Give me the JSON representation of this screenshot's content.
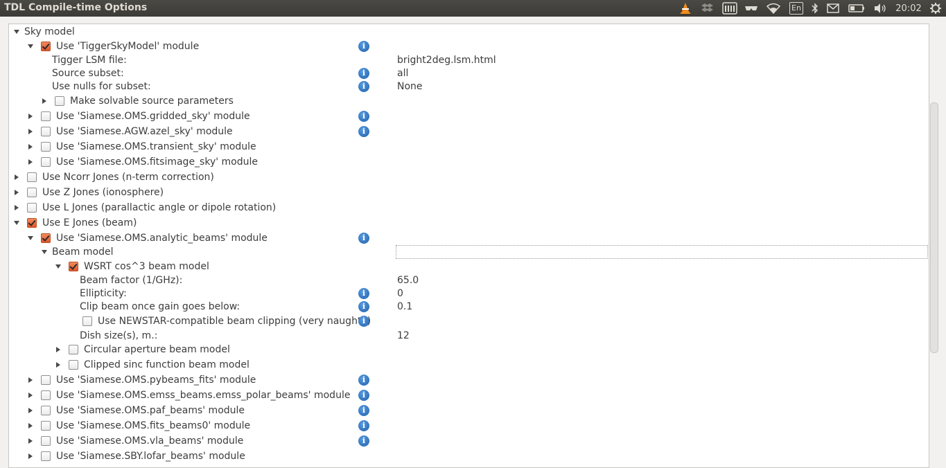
{
  "window": {
    "title": "TDL Compile-time Options"
  },
  "tray": {
    "icons": [
      "vlc-icon",
      "dropbox-icon",
      "im-icon",
      "spy-icon",
      "wifi-icon",
      "keyboard-layout-icon",
      "bluetooth-icon",
      "mail-icon",
      "battery-icon",
      "volume-icon",
      "power-gear-icon"
    ],
    "keyboard_label": "En",
    "clock": "20:02"
  },
  "tree": {
    "sky_model": {
      "label": "Sky model"
    },
    "tigger": {
      "label": "Use 'TiggerSkyModel' module"
    },
    "tigger_lsm": {
      "label": "Tigger LSM file:",
      "value": "bright2deg.lsm.html"
    },
    "source_subset": {
      "label": "Source subset:",
      "value": "all"
    },
    "nulls_subset": {
      "label": "Use nulls for subset:",
      "value": "None"
    },
    "solvable": {
      "label": "Make solvable source parameters"
    },
    "gridded": {
      "label": "Use 'Siamese.OMS.gridded_sky' module"
    },
    "azel": {
      "label": "Use 'Siamese.AGW.azel_sky' module"
    },
    "transient": {
      "label": "Use 'Siamese.OMS.transient_sky' module"
    },
    "fitsimage": {
      "label": "Use 'Siamese.OMS.fitsimage_sky' module"
    },
    "ncorr": {
      "label": "Use Ncorr Jones (n-term correction)"
    },
    "zjones": {
      "label": "Use Z Jones (ionosphere)"
    },
    "ljones": {
      "label": "Use L Jones (parallactic angle or dipole rotation)"
    },
    "ejones": {
      "label": "Use E Jones (beam)"
    },
    "analytic": {
      "label": "Use 'Siamese.OMS.analytic_beams' module"
    },
    "beam_model": {
      "label": "Beam model"
    },
    "wsrt": {
      "label": "WSRT cos^3 beam model"
    },
    "beam_factor": {
      "label": "Beam factor (1/GHz):",
      "value": "65.0"
    },
    "ellipticity": {
      "label": "Ellipticity:",
      "value": "0"
    },
    "clip_beam": {
      "label": "Clip beam once gain goes below:",
      "value": "0.1"
    },
    "newstar": {
      "label": "Use NEWSTAR-compatible beam clipping (very naughty)"
    },
    "dish": {
      "label": "Dish size(s), m.:",
      "value": "12"
    },
    "circular": {
      "label": "Circular aperture beam model"
    },
    "sinc": {
      "label": "Clipped sinc function beam model"
    },
    "pybeams": {
      "label": "Use 'Siamese.OMS.pybeams_fits' module"
    },
    "emss": {
      "label": "Use 'Siamese.OMS.emss_beams.emss_polar_beams' module"
    },
    "paf": {
      "label": "Use 'Siamese.OMS.paf_beams' module"
    },
    "fits0": {
      "label": "Use 'Siamese.OMS.fits_beams0' module"
    },
    "vla": {
      "label": "Use 'Siamese.OMS.vla_beams' module"
    },
    "lofar": {
      "label": "Use 'Siamese.SBY.lofar_beams' module"
    }
  },
  "colors": {
    "check_accent": "#e0562b",
    "info_blue": "#1d5fab",
    "titlebar": "#3c3b37"
  }
}
